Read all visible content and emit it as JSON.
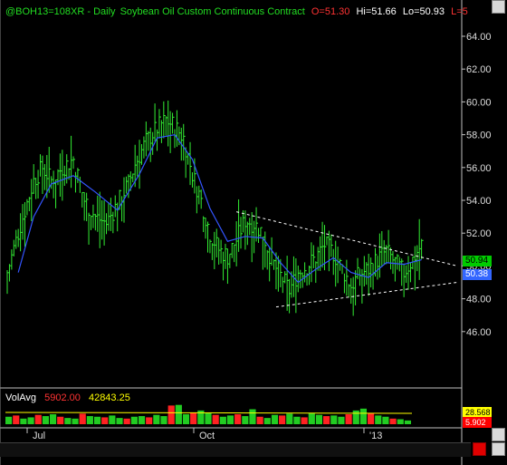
{
  "header": {
    "symbol": "@BOH13=108XR",
    "interval": "- Daily",
    "description": "Soybean Oil Custom Continuous Contract",
    "open": "O=51.30",
    "high": "Hi=51.66",
    "low": "Lo=50.93",
    "last": "L=5"
  },
  "volume_panel": {
    "label": "VolAvg",
    "volume": "5902.00",
    "avg": "42843.25",
    "scale_top": "28.568",
    "scale_bottom": "5.902"
  },
  "price_tags": {
    "last": "50.94",
    "ma": "50.38"
  },
  "colors": {
    "bars": "#33ee33",
    "ma": "#3355ff",
    "trendline": "#ffffff",
    "open_text": "#ff3333",
    "hilo_text": "#ffffff",
    "desc_text": "#22dd22",
    "symbol_text": "#22dd22",
    "vol_avg_line": "#ffff00",
    "last_tag_bg": "#00cc00",
    "ma_tag_bg": "#3366ff"
  },
  "chart_data": {
    "type": "bar",
    "title": "@BOH13=108XR - Daily Soybean Oil Custom Continuous Contract",
    "ylim": [
      44,
      65
    ],
    "yticks": [
      "64.00",
      "62.00",
      "60.00",
      "58.00",
      "56.00",
      "54.00",
      "52.00",
      "50.00",
      "48.00",
      "46.00"
    ],
    "xticks": [
      "Jul",
      "Oct",
      "'13"
    ],
    "price_path": [
      [
        0,
        49.6
      ],
      [
        6,
        52.5
      ],
      [
        12,
        55.2
      ],
      [
        16,
        56.0
      ],
      [
        20,
        55.2
      ],
      [
        25,
        56.0
      ],
      [
        30,
        56.5
      ],
      [
        35,
        54.0
      ],
      [
        40,
        53.0
      ],
      [
        45,
        52.6
      ],
      [
        50,
        53.8
      ],
      [
        55,
        55.0
      ],
      [
        58,
        56.2
      ],
      [
        63,
        57.6
      ],
      [
        68,
        58.4
      ],
      [
        72,
        58.9
      ],
      [
        76,
        58.5
      ],
      [
        80,
        57.8
      ],
      [
        84,
        55.6
      ],
      [
        88,
        54.0
      ],
      [
        92,
        52.0
      ],
      [
        96,
        51.0
      ],
      [
        100,
        50.6
      ],
      [
        104,
        51.6
      ],
      [
        108,
        52.8
      ],
      [
        112,
        52.6
      ],
      [
        116,
        52.0
      ],
      [
        120,
        50.3
      ],
      [
        124,
        49.4
      ],
      [
        128,
        48.5
      ],
      [
        132,
        49.6
      ],
      [
        136,
        50.0
      ],
      [
        140,
        50.5
      ],
      [
        144,
        51.3
      ],
      [
        148,
        50.8
      ],
      [
        152,
        49.8
      ],
      [
        156,
        48.8
      ],
      [
        160,
        49.5
      ],
      [
        164,
        49.8
      ],
      [
        168,
        50.4
      ],
      [
        172,
        50.9
      ],
      [
        176,
        50.2
      ],
      [
        180,
        49.6
      ],
      [
        184,
        50.4
      ],
      [
        188,
        51.3
      ]
    ],
    "moving_average_path": [
      [
        5,
        49.6
      ],
      [
        12,
        53.0
      ],
      [
        20,
        55.0
      ],
      [
        30,
        55.5
      ],
      [
        40,
        54.5
      ],
      [
        50,
        53.4
      ],
      [
        60,
        55.6
      ],
      [
        68,
        57.8
      ],
      [
        76,
        58.0
      ],
      [
        84,
        56.5
      ],
      [
        92,
        53.5
      ],
      [
        100,
        51.5
      ],
      [
        108,
        51.8
      ],
      [
        116,
        51.7
      ],
      [
        124,
        50.2
      ],
      [
        132,
        49.0
      ],
      [
        140,
        49.8
      ],
      [
        148,
        50.5
      ],
      [
        156,
        49.6
      ],
      [
        164,
        49.3
      ],
      [
        172,
        50.2
      ],
      [
        180,
        50.1
      ],
      [
        188,
        50.38
      ]
    ],
    "trendlines": [
      {
        "from": [
          104,
          53.3
        ],
        "to": [
          205,
          50.0
        ]
      },
      {
        "from": [
          122,
          47.5
        ],
        "to": [
          205,
          49.0
        ]
      }
    ],
    "volume": [
      12000,
      14000,
      9000,
      11000,
      15000,
      13000,
      16000,
      12000,
      10000,
      9000,
      17000,
      13000,
      12000,
      11000,
      14000,
      10000,
      9000,
      12000,
      13000,
      11000,
      15000,
      13000,
      30000,
      31000,
      16000,
      19000,
      22000,
      18000,
      15000,
      12000,
      14000,
      16000,
      13000,
      24000,
      12000,
      10000,
      15000,
      14000,
      17000,
      12000,
      11000,
      18000,
      15000,
      13000,
      14000,
      12000,
      16000,
      22000,
      25000,
      18000,
      14000,
      12000,
      9000,
      8000,
      6000
    ]
  }
}
